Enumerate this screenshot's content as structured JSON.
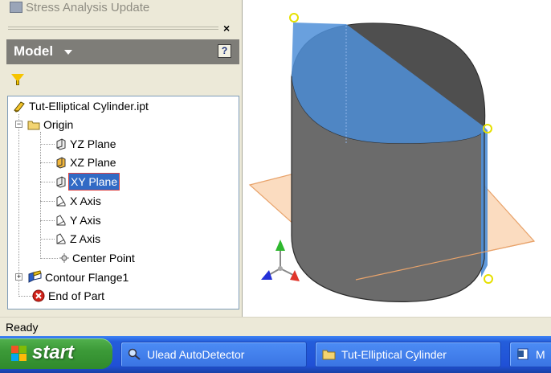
{
  "top_command": {
    "label": "Stress Analysis Update"
  },
  "browser": {
    "header_label": "Model",
    "help_label": "?",
    "close_label": "×"
  },
  "tree": {
    "root": "Tut-Elliptical Cylinder.ipt",
    "origin": "Origin",
    "items": [
      {
        "label": "YZ Plane"
      },
      {
        "label": "XZ Plane"
      },
      {
        "label": "XY Plane"
      },
      {
        "label": "X Axis"
      },
      {
        "label": "Y Axis"
      },
      {
        "label": "Z Axis"
      },
      {
        "label": "Center Point"
      }
    ],
    "feature": "Contour Flange1",
    "end": "End of Part"
  },
  "status": {
    "text": "Ready"
  },
  "taskbar": {
    "start_label": "start",
    "tasks": [
      {
        "label": "Ulead AutoDetector"
      },
      {
        "label": "Tut-Elliptical Cylinder"
      },
      {
        "label": "M"
      }
    ]
  },
  "colors": {
    "plane_fill": "#fbdcc0",
    "plane_edge": "#e8a36b",
    "cylinder_gray": "#6a6a6a",
    "cylinder_blue": "#4f8fd8",
    "axis_x": "#e0352b",
    "axis_y": "#2fb82f",
    "axis_z": "#2430d8"
  }
}
